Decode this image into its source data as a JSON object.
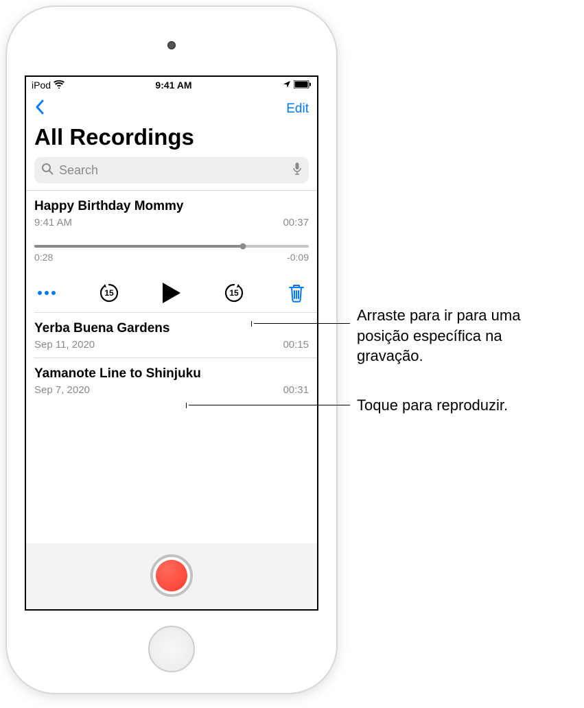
{
  "status": {
    "device": "iPod",
    "time": "9:41 AM"
  },
  "nav": {
    "edit_label": "Edit"
  },
  "header": {
    "title": "All Recordings"
  },
  "search": {
    "placeholder": "Search"
  },
  "expanded": {
    "title": "Happy Birthday Mommy",
    "time": "9:41 AM",
    "duration": "00:37",
    "elapsed": "0:28",
    "remaining": "-0:09",
    "skip_back": "15",
    "skip_forward": "15"
  },
  "recordings": [
    {
      "title": "Yerba Buena Gardens",
      "date": "Sep 11, 2020",
      "duration": "00:15"
    },
    {
      "title": "Yamanote Line to Shinjuku",
      "date": "Sep 7, 2020",
      "duration": "00:31"
    }
  ],
  "callouts": {
    "scrubber": "Arraste para ir para uma posição específica na gravação.",
    "play": "Toque para reproduzir."
  },
  "colors": {
    "accent": "#007aff",
    "danger": "#fe3b30"
  }
}
